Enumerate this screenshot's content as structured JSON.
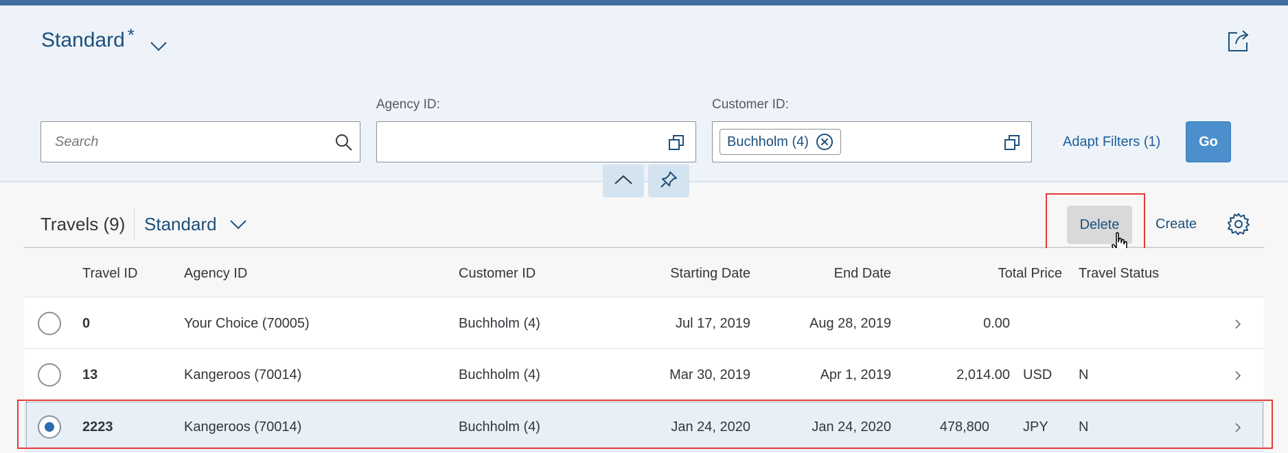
{
  "header": {
    "variant_title": "Standard",
    "dirty_marker": "*"
  },
  "filters": {
    "search_placeholder": "Search",
    "agency_label": "Agency ID:",
    "customer_label": "Customer ID:",
    "customer_token": "Buchholm (4)",
    "adapt_filters_label": "Adapt Filters (1)",
    "go_label": "Go"
  },
  "toolbar": {
    "title": "Travels (9)",
    "variant": "Standard",
    "delete_label": "Delete",
    "create_label": "Create"
  },
  "columns": {
    "travel_id": "Travel ID",
    "agency_id": "Agency ID",
    "customer_id": "Customer ID",
    "starting_date": "Starting Date",
    "end_date": "End Date",
    "total_price": "Total Price",
    "travel_status": "Travel Status"
  },
  "rows": [
    {
      "travel_id": "0",
      "agency": "Your Choice (70005)",
      "customer": "Buchholm (4)",
      "start": "Jul 17, 2019",
      "end": "Aug 28, 2019",
      "price": "0.00",
      "currency": "",
      "status": "",
      "selected": false
    },
    {
      "travel_id": "13",
      "agency": "Kangeroos (70014)",
      "customer": "Buchholm (4)",
      "start": "Mar 30, 2019",
      "end": "Apr 1, 2019",
      "price": "2,014.00",
      "currency": "USD",
      "status": "N",
      "selected": false
    },
    {
      "travel_id": "2223",
      "agency": "Kangeroos (70014)",
      "customer": "Buchholm (4)",
      "start": "Jan 24, 2020",
      "end": "Jan 24, 2020",
      "price": "478,800",
      "currency": "JPY",
      "status": "N",
      "selected": true
    }
  ],
  "colors": {
    "brand": "#3f6fa1",
    "link": "#1d4f7b",
    "go_button": "#4b8fcc",
    "highlight": "#e53935",
    "selected_row": "#e7eff7"
  },
  "icons": {
    "share": "share-icon",
    "search": "search-icon",
    "value_help": "value-help-icon",
    "token_remove": "close-circle-icon",
    "collapse": "chevron-up-icon",
    "pin": "pin-icon",
    "settings": "gear-icon",
    "row_nav": "chevron-right-icon"
  }
}
